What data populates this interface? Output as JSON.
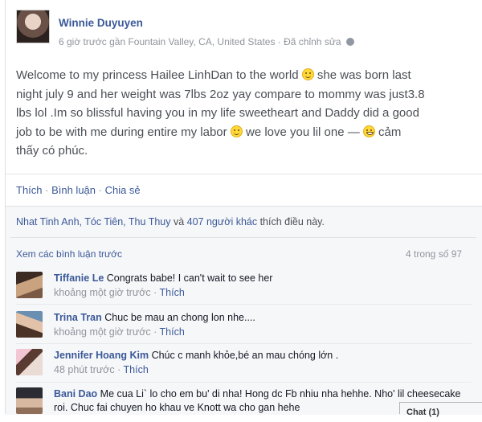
{
  "post": {
    "author": "Winnie Duyuyen",
    "meta": "6 giờ trước gần Fountain Valley, CA, United States · Đã chỉnh sửa",
    "lines": [
      "Welcome to my princess Hailee LinhDan to the world",
      " she was born last",
      "night july 9 and her weight was 7lbs 2oz yay compare to mommy was just3.8",
      "lbs lol .Im so blissful having you in my life sweetheart and Daddy did a good",
      "job to be with me during entire my labor",
      " we love you lil one —",
      " cảm",
      "thấy có phúc."
    ]
  },
  "actions": {
    "like": "Thích",
    "comment": "Bình luận",
    "share": "Chia sẻ",
    "dot": " · "
  },
  "likes": {
    "names": "Nhat Tinh Anh, Tóc Tiên, Thu Thuy",
    "and": " và ",
    "others": "407 người khác",
    "suffix": " thích điều này."
  },
  "comments_header": {
    "view_previous": "Xem các bình luận trước",
    "count": "4 trong số 97"
  },
  "comments": [
    {
      "name": "Tiffanie Le",
      "text": "Congrats babe! I can't wait to see her",
      "time": "khoảng một giờ trước",
      "like": "Thích"
    },
    {
      "name": "Trina Tran",
      "text": "Chuc be mau an chong lon nhe....",
      "time": "khoảng một giờ trước",
      "like": "Thích"
    },
    {
      "name": "Jennifer Hoang Kim",
      "text": "Chúc c manh khỏe,bé an mau chóng lớn .",
      "time": "48 phút trước",
      "like": "Thích"
    },
    {
      "name": "Bani Dao",
      "text": "Me cua Li` lo cho em bu' di nha! Hong dc Fb nhiu nha hehhe. Nho' lil cheesecake roi. Chuc fai chuyen ho khau ve Knott wa cho gan hehe"
    }
  ],
  "chat": {
    "label": "Chat (1)"
  },
  "colors": {
    "link": "#3b5998",
    "meta": "#90949c",
    "body": "#4b4f56"
  }
}
